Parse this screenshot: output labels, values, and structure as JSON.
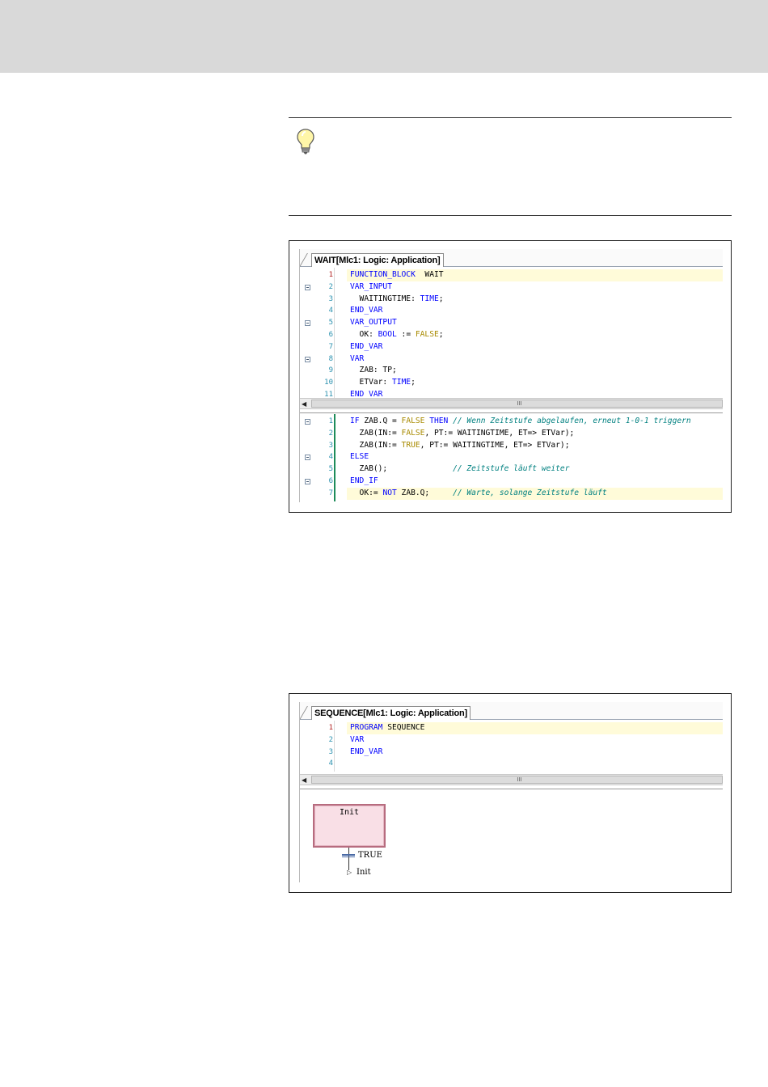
{
  "figure1": {
    "tab_title": "WAIT[Mlc1: Logic: Application]",
    "declaration_lines": [
      {
        "n": "1",
        "fold": false,
        "hl": true,
        "segs": [
          [
            "kw",
            "FUNCTION_BLOCK"
          ],
          [
            "",
            "  WAIT"
          ]
        ]
      },
      {
        "n": "2",
        "fold": true,
        "hl": false,
        "segs": [
          [
            "kw",
            "VAR_INPUT"
          ]
        ]
      },
      {
        "n": "3",
        "fold": false,
        "hl": false,
        "segs": [
          [
            "",
            "  WAITINGTIME: "
          ],
          [
            "kw",
            "TIME"
          ],
          [
            "",
            ";"
          ]
        ]
      },
      {
        "n": "4",
        "fold": false,
        "hl": false,
        "segs": [
          [
            "kw",
            "END_VAR"
          ]
        ]
      },
      {
        "n": "5",
        "fold": true,
        "hl": false,
        "segs": [
          [
            "kw",
            "VAR_OUTPUT"
          ]
        ]
      },
      {
        "n": "6",
        "fold": false,
        "hl": false,
        "segs": [
          [
            "",
            "  OK: "
          ],
          [
            "kw",
            "BOOL"
          ],
          [
            "",
            " := "
          ],
          [
            "bool",
            "FALSE"
          ],
          [
            "",
            ";"
          ]
        ]
      },
      {
        "n": "7",
        "fold": false,
        "hl": false,
        "segs": [
          [
            "kw",
            "END_VAR"
          ]
        ]
      },
      {
        "n": "8",
        "fold": true,
        "hl": false,
        "segs": [
          [
            "kw",
            "VAR"
          ]
        ]
      },
      {
        "n": "9",
        "fold": false,
        "hl": false,
        "segs": [
          [
            "",
            "  ZAB: TP;"
          ]
        ]
      },
      {
        "n": "10",
        "fold": false,
        "hl": false,
        "segs": [
          [
            "",
            "  ETVar: "
          ],
          [
            "kw",
            "TIME"
          ],
          [
            "",
            ";"
          ]
        ]
      },
      {
        "n": "11",
        "fold": false,
        "hl": false,
        "segs": [
          [
            "kw",
            "END_VAR"
          ]
        ]
      }
    ],
    "body_lines": [
      {
        "n": "1",
        "fold": true,
        "hl": false,
        "segs": [
          [
            "kw",
            "IF"
          ],
          [
            "",
            " ZAB.Q = "
          ],
          [
            "bool",
            "FALSE"
          ],
          [
            "",
            " "
          ],
          [
            "kw",
            "THEN"
          ],
          [
            "",
            " "
          ],
          [
            "cm",
            "// Wenn Zeitstufe abgelaufen, erneut 1-0-1 triggern"
          ]
        ]
      },
      {
        "n": "2",
        "fold": false,
        "hl": false,
        "segs": [
          [
            "",
            "  ZAB(IN:= "
          ],
          [
            "bool",
            "FALSE"
          ],
          [
            "",
            ", PT:= WAITINGTIME, ET=> ETVar);"
          ]
        ]
      },
      {
        "n": "3",
        "fold": false,
        "hl": false,
        "segs": [
          [
            "",
            "  ZAB(IN:= "
          ],
          [
            "bool",
            "TRUE"
          ],
          [
            "",
            ", PT:= WAITINGTIME, ET=> ETVar);"
          ]
        ]
      },
      {
        "n": "4",
        "fold": true,
        "hl": false,
        "segs": [
          [
            "kw",
            "ELSE"
          ]
        ]
      },
      {
        "n": "5",
        "fold": false,
        "hl": false,
        "segs": [
          [
            "",
            "  ZAB();              "
          ],
          [
            "cm",
            "// Zeitstufe läuft weiter"
          ]
        ]
      },
      {
        "n": "6",
        "fold": true,
        "hl": false,
        "segs": [
          [
            "kw",
            "END_IF"
          ]
        ]
      },
      {
        "n": "7",
        "fold": false,
        "hl": true,
        "segs": [
          [
            "",
            "  OK:= "
          ],
          [
            "kw",
            "NOT"
          ],
          [
            "",
            " ZAB.Q;     "
          ],
          [
            "cm",
            "// Warte, solange Zeitstufe läuft"
          ]
        ]
      }
    ],
    "scroll_grip": "III"
  },
  "figure2": {
    "tab_title": "SEQUENCE[Mlc1: Logic: Application]",
    "declaration_lines": [
      {
        "n": "1",
        "fold": false,
        "hl": true,
        "segs": [
          [
            "kw",
            "PROGRAM"
          ],
          [
            "",
            " SEQUENCE"
          ]
        ]
      },
      {
        "n": "2",
        "fold": false,
        "hl": false,
        "segs": [
          [
            "kw",
            "VAR"
          ]
        ]
      },
      {
        "n": "3",
        "fold": false,
        "hl": false,
        "segs": [
          [
            "kw",
            "END_VAR"
          ]
        ]
      },
      {
        "n": "4",
        "fold": false,
        "hl": false,
        "segs": []
      }
    ],
    "scroll_grip": "III",
    "sfc": {
      "step_label": "Init",
      "transition_label": "TRUE",
      "jump_label": "Init"
    }
  },
  "colors": {
    "keyword": "#0000ff",
    "boolean": "#a88a00",
    "comment": "#008080",
    "line_number": "#2b91af",
    "highlight": "#fffbd9"
  }
}
